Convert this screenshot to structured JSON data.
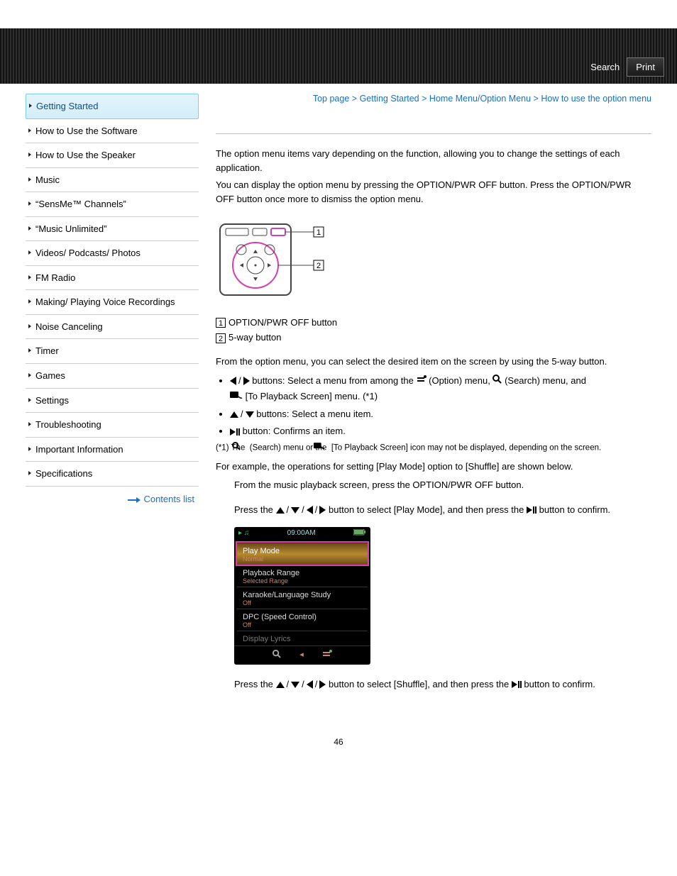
{
  "header": {
    "search_label": "Search",
    "print_label": "Print"
  },
  "sidebar": {
    "items": [
      {
        "label": "Getting Started",
        "active": true
      },
      {
        "label": "How to Use the Software"
      },
      {
        "label": "How to Use the Speaker"
      },
      {
        "label": "Music"
      },
      {
        "label": "“SensMe™ Channels”"
      },
      {
        "label": "“Music Unlimited”"
      },
      {
        "label": "Videos/ Podcasts/ Photos"
      },
      {
        "label": "FM Radio"
      },
      {
        "label": "Making/ Playing Voice Recordings"
      },
      {
        "label": "Noise Canceling"
      },
      {
        "label": "Timer"
      },
      {
        "label": "Games"
      },
      {
        "label": "Settings"
      },
      {
        "label": "Troubleshooting"
      },
      {
        "label": "Important Information"
      },
      {
        "label": "Specifications"
      }
    ],
    "contents_list": "Contents list"
  },
  "breadcrumb": {
    "top": "Top page",
    "b1": "Getting Started",
    "b2": "Home Menu/Option Menu",
    "current": "How to use the option menu",
    "sep": ">"
  },
  "body": {
    "p1": "The option menu items vary depending on the function, allowing you to change the settings of each application.",
    "p2": "You can display the option menu by pressing the OPTION/PWR OFF button. Press the OPTION/PWR OFF button once more to dismiss the option menu.",
    "legend1": "OPTION/PWR OFF button",
    "legend2": "5-way button",
    "p3": "From the option menu, you can select the desired item on the screen by using the 5-way button.",
    "bullet1a": " buttons: Select a menu from among the ",
    "bullet1b": "(Option) menu, ",
    "bullet1c": "(Search) menu, and ",
    "bullet1d": "[To Playback Screen] menu. (*1)",
    "bullet2": " buttons: Select a menu item.",
    "bullet3": " button: Confirms an item.",
    "footnote_pre": "(*1) The",
    "footnote_mid1": "(Search) menu or the ",
    "footnote_mid2": "[To Playback Screen] icon may not be displayed, depending on the screen.",
    "example_intro": "For example, the operations for setting [Play Mode] option to [Shuffle] are shown below.",
    "step1": "From the music playback screen, press the OPTION/PWR OFF button.",
    "step2a": "Press the ",
    "step2b": " button to select [Play Mode], and then press the ",
    "step2c": " button to confirm.",
    "step3a": "Press the ",
    "step3b": " button to select [Shuffle], and then press the ",
    "step3c": " button to confirm."
  },
  "device_screen": {
    "time": "09:00AM",
    "rows": [
      {
        "title": "Play Mode",
        "sub": "Normal",
        "selected": true
      },
      {
        "title": "Playback Range",
        "sub": "Selected Range"
      },
      {
        "title": "Karaoke/Language Study",
        "sub": "Off"
      },
      {
        "title": "DPC (Speed Control)",
        "sub": "Off"
      },
      {
        "title": "Display Lyrics",
        "sub": "",
        "dim": true
      }
    ]
  },
  "page_number": "46"
}
